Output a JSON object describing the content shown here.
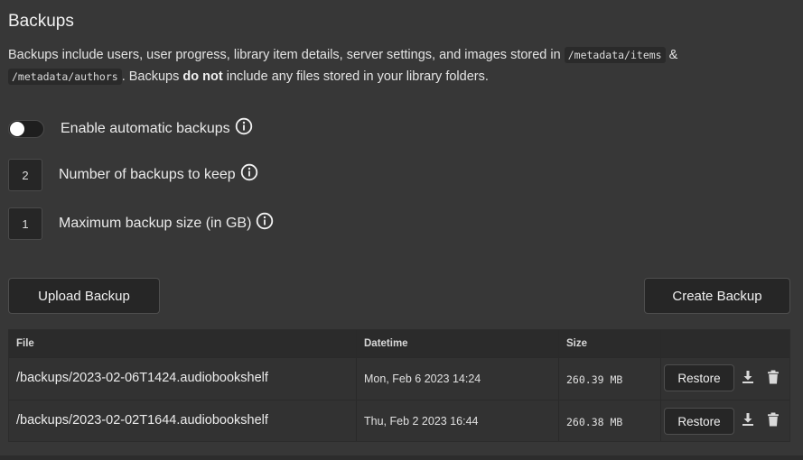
{
  "page": {
    "title": "Backups",
    "description": {
      "p1": "Backups include users, user progress, library item details, server settings, and images stored in ",
      "code1": "/metadata/items",
      "p2": " & ",
      "code2": "/metadata/authors",
      "p3": ". Backups ",
      "bold": "do not",
      "p4": " include any files stored in your library folders."
    }
  },
  "settings": {
    "auto_backup": {
      "label": "Enable automatic backups",
      "enabled": false
    },
    "keep_count": {
      "label": "Number of backups to keep",
      "value": "2"
    },
    "max_size": {
      "label": "Maximum backup size (in GB)",
      "value": "1"
    }
  },
  "actions": {
    "upload_label": "Upload Backup",
    "create_label": "Create Backup"
  },
  "table": {
    "headers": {
      "file": "File",
      "datetime": "Datetime",
      "size": "Size"
    },
    "rows": [
      {
        "file": "/backups/2023-02-06T1424.audiobookshelf",
        "datetime": "Mon, Feb 6 2023 14:24",
        "size": "260.39 MB",
        "restore_label": "Restore"
      },
      {
        "file": "/backups/2023-02-02T1644.audiobookshelf",
        "datetime": "Thu, Feb 2 2023 16:44",
        "size": "260.38 MB",
        "restore_label": "Restore"
      }
    ]
  },
  "icons": {
    "info": "info-circle-icon",
    "download": "download-icon",
    "delete": "trash-icon"
  },
  "colors": {
    "background": "#373737",
    "surface": "#262626",
    "text": "#e6e6e6"
  }
}
